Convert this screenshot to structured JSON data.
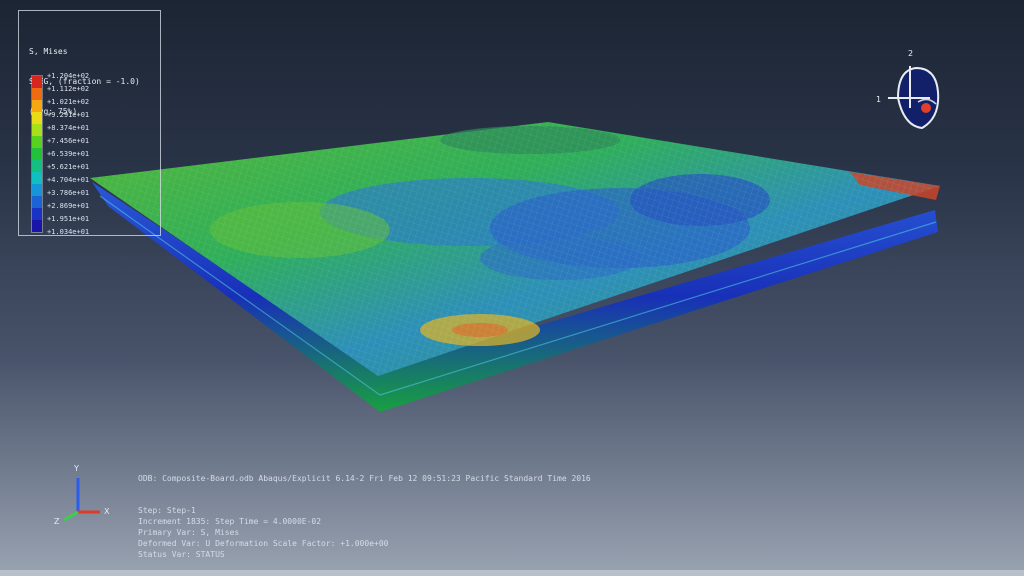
{
  "legend": {
    "title": "S, Mises",
    "subtitle": "SNEG, (fraction = -1.0)",
    "avg": "(Avg: 75%)",
    "levels": [
      "+1.204e+02",
      "+1.112e+02",
      "+1.021e+02",
      "+9.291e+01",
      "+8.374e+01",
      "+7.456e+01",
      "+6.539e+01",
      "+5.621e+01",
      "+4.704e+01",
      "+3.786e+01",
      "+2.869e+01",
      "+1.951e+01",
      "+1.034e+01"
    ],
    "colors": [
      "#d7261e",
      "#f06a0f",
      "#f6a811",
      "#e9dc16",
      "#a8e01a",
      "#58d21c",
      "#1fc23a",
      "#13c07f",
      "#10bfc0",
      "#1496d8",
      "#1a64d6",
      "#1a33c4",
      "#1a14a8"
    ]
  },
  "view_cube": {
    "axis_y": "2",
    "axis_x": "1"
  },
  "triad": {
    "y": "Y",
    "x": "X",
    "z": "Z"
  },
  "info": {
    "odb_line": "ODB: Composite-Board.odb    Abaqus/Explicit 6.14-2    Fri Feb 12 09:51:23 Pacific Standard Time 2016",
    "step_line": "Step: Step-1",
    "increment_line": "Increment    1835: Step Time =    4.0000E-02",
    "primary_line": "Primary Var: S, Mises",
    "deformed_line": "Deformed Var: U   Deformation Scale Factor: +1.000e+00",
    "status_line": "Status Var: STATUS"
  },
  "colors": {
    "plate_mid": "#3aa24a",
    "plate_edge_blue": "#1a3fc8",
    "background_top": "#1c2533"
  }
}
